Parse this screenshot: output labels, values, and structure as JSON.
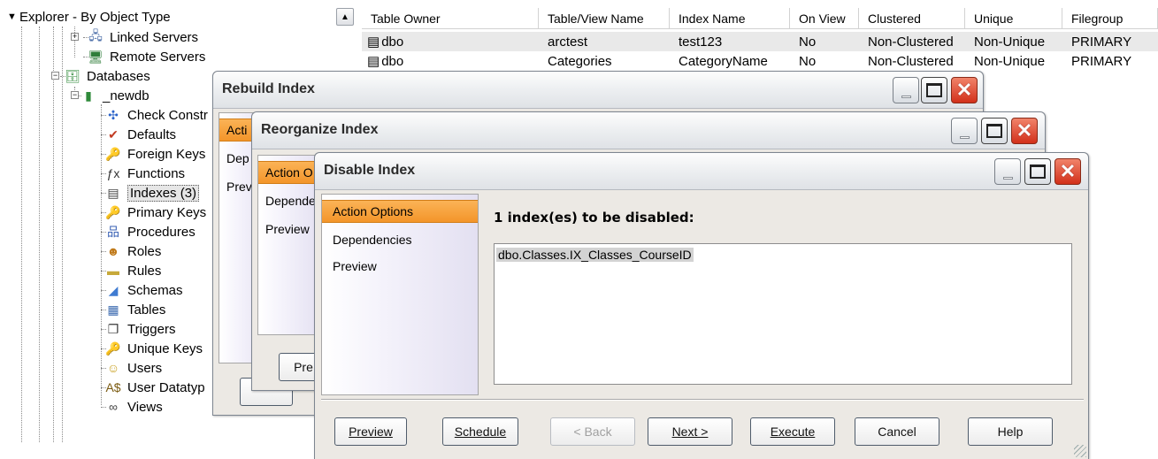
{
  "explorer": {
    "header": "Explorer - By Object Type",
    "collapse_symbol": "▼",
    "scroll_up_symbol": "▲",
    "items": [
      {
        "label": "Linked Servers",
        "icon": "linked-servers-icon",
        "glyph": "🖧"
      },
      {
        "label": "Remote Servers",
        "icon": "remote-servers-icon",
        "glyph": "🖥"
      },
      {
        "label": "Databases",
        "icon": "databases-icon",
        "glyph": "🗄"
      },
      {
        "label": "_newdb",
        "icon": "database-icon",
        "glyph": "▮"
      },
      {
        "label": "Check Constr",
        "icon": "check-constraint-icon",
        "glyph": "✣"
      },
      {
        "label": "Defaults",
        "icon": "defaults-icon",
        "glyph": "✔"
      },
      {
        "label": "Foreign Keys",
        "icon": "foreign-keys-icon",
        "glyph": "🔑"
      },
      {
        "label": "Functions",
        "icon": "functions-icon",
        "glyph": "ƒx"
      },
      {
        "label": "Indexes (3)",
        "icon": "indexes-icon",
        "glyph": "▤"
      },
      {
        "label": "Primary Keys",
        "icon": "primary-keys-icon",
        "glyph": "🔑"
      },
      {
        "label": "Procedures",
        "icon": "procedures-icon",
        "glyph": "品"
      },
      {
        "label": "Roles",
        "icon": "roles-icon",
        "glyph": "☻"
      },
      {
        "label": "Rules",
        "icon": "rules-icon",
        "glyph": "▬"
      },
      {
        "label": "Schemas",
        "icon": "schemas-icon",
        "glyph": "◢"
      },
      {
        "label": "Tables",
        "icon": "tables-icon",
        "glyph": "▦"
      },
      {
        "label": "Triggers",
        "icon": "triggers-icon",
        "glyph": "❐"
      },
      {
        "label": "Unique Keys",
        "icon": "unique-keys-icon",
        "glyph": "🔑"
      },
      {
        "label": "Users",
        "icon": "users-icon",
        "glyph": "☺"
      },
      {
        "label": "User Datatyp",
        "icon": "user-datatypes-icon",
        "glyph": "A$"
      },
      {
        "label": "Views",
        "icon": "views-icon",
        "glyph": "∞"
      }
    ]
  },
  "grid": {
    "columns": [
      "Table Owner",
      "Table/View Name",
      "Index Name",
      "On View",
      "Clustered",
      "Unique",
      "Filegroup"
    ],
    "rows": [
      [
        "dbo",
        "arctest",
        "test123",
        "No",
        "Non-Clustered",
        "Non-Unique",
        "PRIMARY"
      ],
      [
        "dbo",
        "Categories",
        "CategoryName",
        "No",
        "Non-Clustered",
        "Non-Unique",
        "PRIMARY"
      ]
    ]
  },
  "rebuild_dialog": {
    "title": "Rebuild Index",
    "side": [
      "Acti",
      "Dep",
      "Prev"
    ],
    "button_partial": ""
  },
  "reorganize_dialog": {
    "title": "Reorganize Index",
    "side": [
      "Action O",
      "Dependenc",
      "Preview"
    ],
    "button_partial": "Pre"
  },
  "disable_dialog": {
    "title": "Disable Index",
    "side": [
      "Action Options",
      "Dependencies",
      "Preview"
    ],
    "heading": "1 index(es) to be disabled:",
    "index_item": "dbo.Classes.IX_Classes_CourseID",
    "buttons": {
      "preview": "Preview",
      "schedule": "Schedule",
      "back": "< Back",
      "next": "Next >",
      "execute": "Execute",
      "cancel": "Cancel",
      "help": "Help"
    },
    "close_symbol": "✕"
  },
  "colors": {
    "active_side_item": "#f3952a",
    "close_button": "#d2301a",
    "dialog_background": "#ece9e4"
  }
}
